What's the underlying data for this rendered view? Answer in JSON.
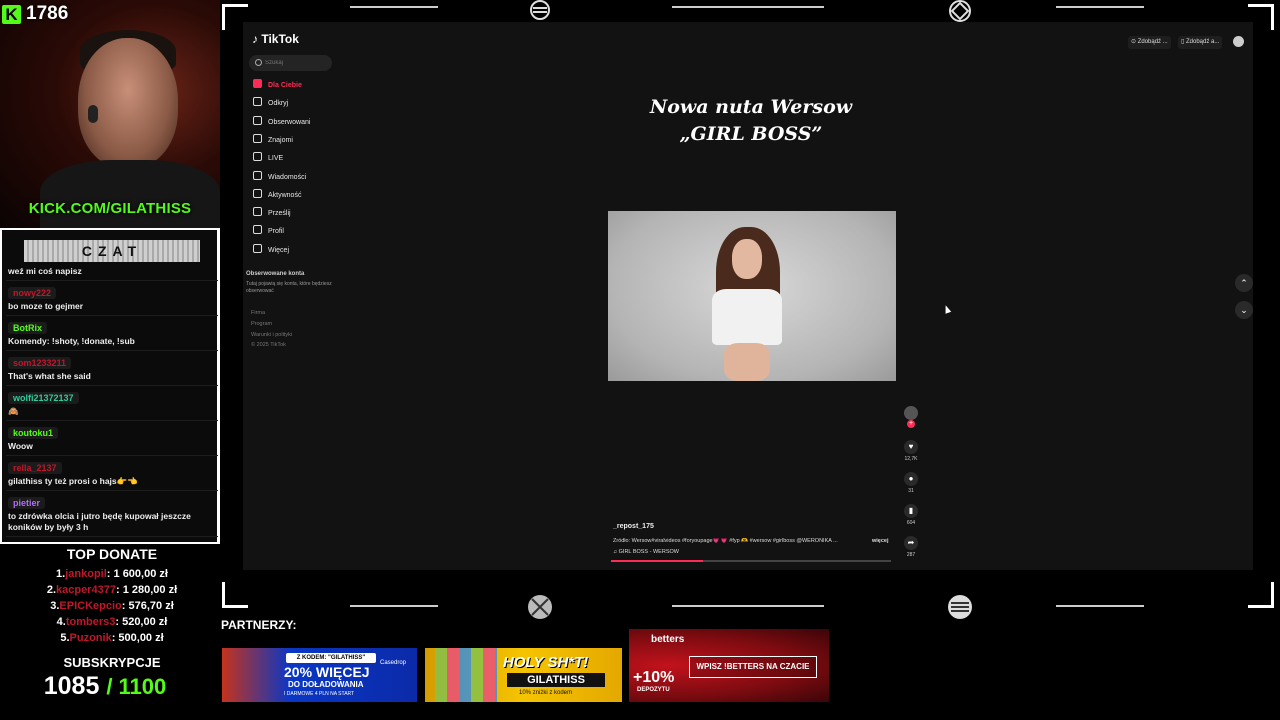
{
  "stream": {
    "viewer_count": "1786",
    "kick_url": "KICK.COM/GILATHISS",
    "chat_title": "CZAT"
  },
  "chat": [
    {
      "user": "",
      "user_color": "#f0c419",
      "text": "weź mi coś napisz"
    },
    {
      "user": "nowy222",
      "user_color": "#c0172b",
      "text": "bo moze to gejmer"
    },
    {
      "user": "BotRix",
      "user_color": "#53fc18",
      "text": "Komendy: !shoty, !donate, !sub"
    },
    {
      "user": "som1233211",
      "user_color": "#c0172b",
      "text": "That's what she said"
    },
    {
      "user": "wolfi21372137",
      "user_color": "#2ecc9a",
      "text": "🙈"
    },
    {
      "user": "koutoku1",
      "user_color": "#53fc18",
      "text": "Woow"
    },
    {
      "user": "rella_2137",
      "user_color": "#c0172b",
      "text": "gilathiss ty też prosi o hajs👉👈"
    },
    {
      "user": "pietier",
      "user_color": "#b06cff",
      "text": "to zdrówka olcia i jutro będę kupował jeszcze koników by były 3 h"
    }
  ],
  "top_donate": {
    "title": "TOP DONATE",
    "entries": [
      {
        "rank": "1.",
        "name": "jankopil",
        "amount": ": 1 600,00 zł"
      },
      {
        "rank": "2.",
        "name": "kacper4377",
        "amount": ": 1 280,00 zł"
      },
      {
        "rank": "3.",
        "name": "EPICKepcio",
        "amount": ": 576,70 zł"
      },
      {
        "rank": "4.",
        "name": "tombers3",
        "amount": ": 520,00 zł"
      },
      {
        "rank": "5.",
        "name": "Puzonik",
        "amount": ": 500,00 zł"
      }
    ]
  },
  "subs": {
    "title": "SUBSKRYPCJE",
    "current": "1085",
    "goal": "/ 1100"
  },
  "tiktok": {
    "logo": "TikTok",
    "search_placeholder": "Szukaj",
    "nav": [
      {
        "label": "Dla Ciebie",
        "icon": "home-icon",
        "active": true
      },
      {
        "label": "Odkryj",
        "icon": "compass-icon"
      },
      {
        "label": "Obserwowani",
        "icon": "following-icon"
      },
      {
        "label": "Znajomi",
        "icon": "friends-icon"
      },
      {
        "label": "LIVE",
        "icon": "live-icon"
      },
      {
        "label": "Wiadomości",
        "icon": "messages-icon"
      },
      {
        "label": "Aktywność",
        "icon": "activity-icon"
      },
      {
        "label": "Prześlij",
        "icon": "upload-icon"
      },
      {
        "label": "Profil",
        "icon": "profile-icon"
      },
      {
        "label": "Więcej",
        "icon": "more-icon"
      }
    ],
    "followed_title": "Obserwowane konta",
    "followed_text": "Tutaj pojawią się konta, które będziesz obserwować",
    "footer": [
      "Firma",
      "Program",
      "Warunki i polityki",
      "© 2025 TikTok"
    ],
    "top_buttons": [
      "Zdobądź ...",
      "Zdobądź a..."
    ],
    "headline_line1": "Nowa nuta Wersow",
    "headline_line2": "„GIRL BOSS”",
    "video": {
      "username": "_repost_175",
      "description": "Źródło: Wersow#viralvideos #foryoupage💗 💗 #fyp 🫶 #wersow #girlboss @WERONIKA ...",
      "more": "więcej",
      "music": "♫ GIRL BOSS - WERSOW",
      "likes": "12,7K",
      "comments": "31",
      "saves": "604",
      "shares": "287",
      "progress": 0.33
    }
  },
  "partners": {
    "label": "PARTNERZY:",
    "casedrop": {
      "code": "Z KODEM: \"GILATHISS\"",
      "headline": "20% WIĘCEJ",
      "line2": "DO DOŁADOWANIA",
      "line3": "I DARMOWE 4 PLN NA START",
      "brand": "Casedrop"
    },
    "holy": {
      "headline": "HOLY SH*T!",
      "code": "GILATHISS",
      "sub": "10% zniżki z kodem"
    },
    "betters": {
      "brand": "betters",
      "bonus": "+10%",
      "deposit": "DEPOZYTU",
      "cta": "WPISZ !BETTERS NA CZACIE"
    }
  }
}
